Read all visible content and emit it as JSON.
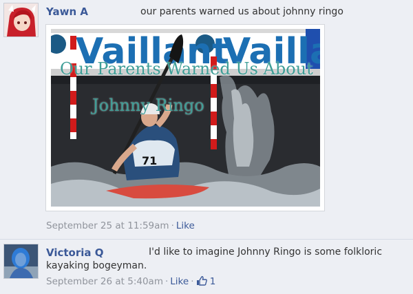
{
  "comments": [
    {
      "author": "Yawn A",
      "text": "our parents warned us about johnny ringo",
      "timestamp": "September 25 at 11:59am",
      "like_label": "Like",
      "photo": {
        "overlay_line1": "Our Parents Warned Us About",
        "overlay_line2": "Johnny Ringo",
        "banner_text": "Vaillant",
        "bib_number": "71"
      }
    },
    {
      "author": "Victoria Q",
      "text_line1": "I'd like to imagine Johnny Ringo is some folkloric",
      "text_line2": "kayaking bogeyman.",
      "timestamp": "September 26 at 5:40am",
      "like_label": "Like",
      "like_count": "1"
    }
  ],
  "colors": {
    "background": "#edeff4",
    "link": "#3b5998",
    "meta": "#90949c",
    "overlay_text": "#3f9e97"
  },
  "icons": [
    "avatar-anime",
    "avatar-blue",
    "thumbs-up-icon"
  ]
}
